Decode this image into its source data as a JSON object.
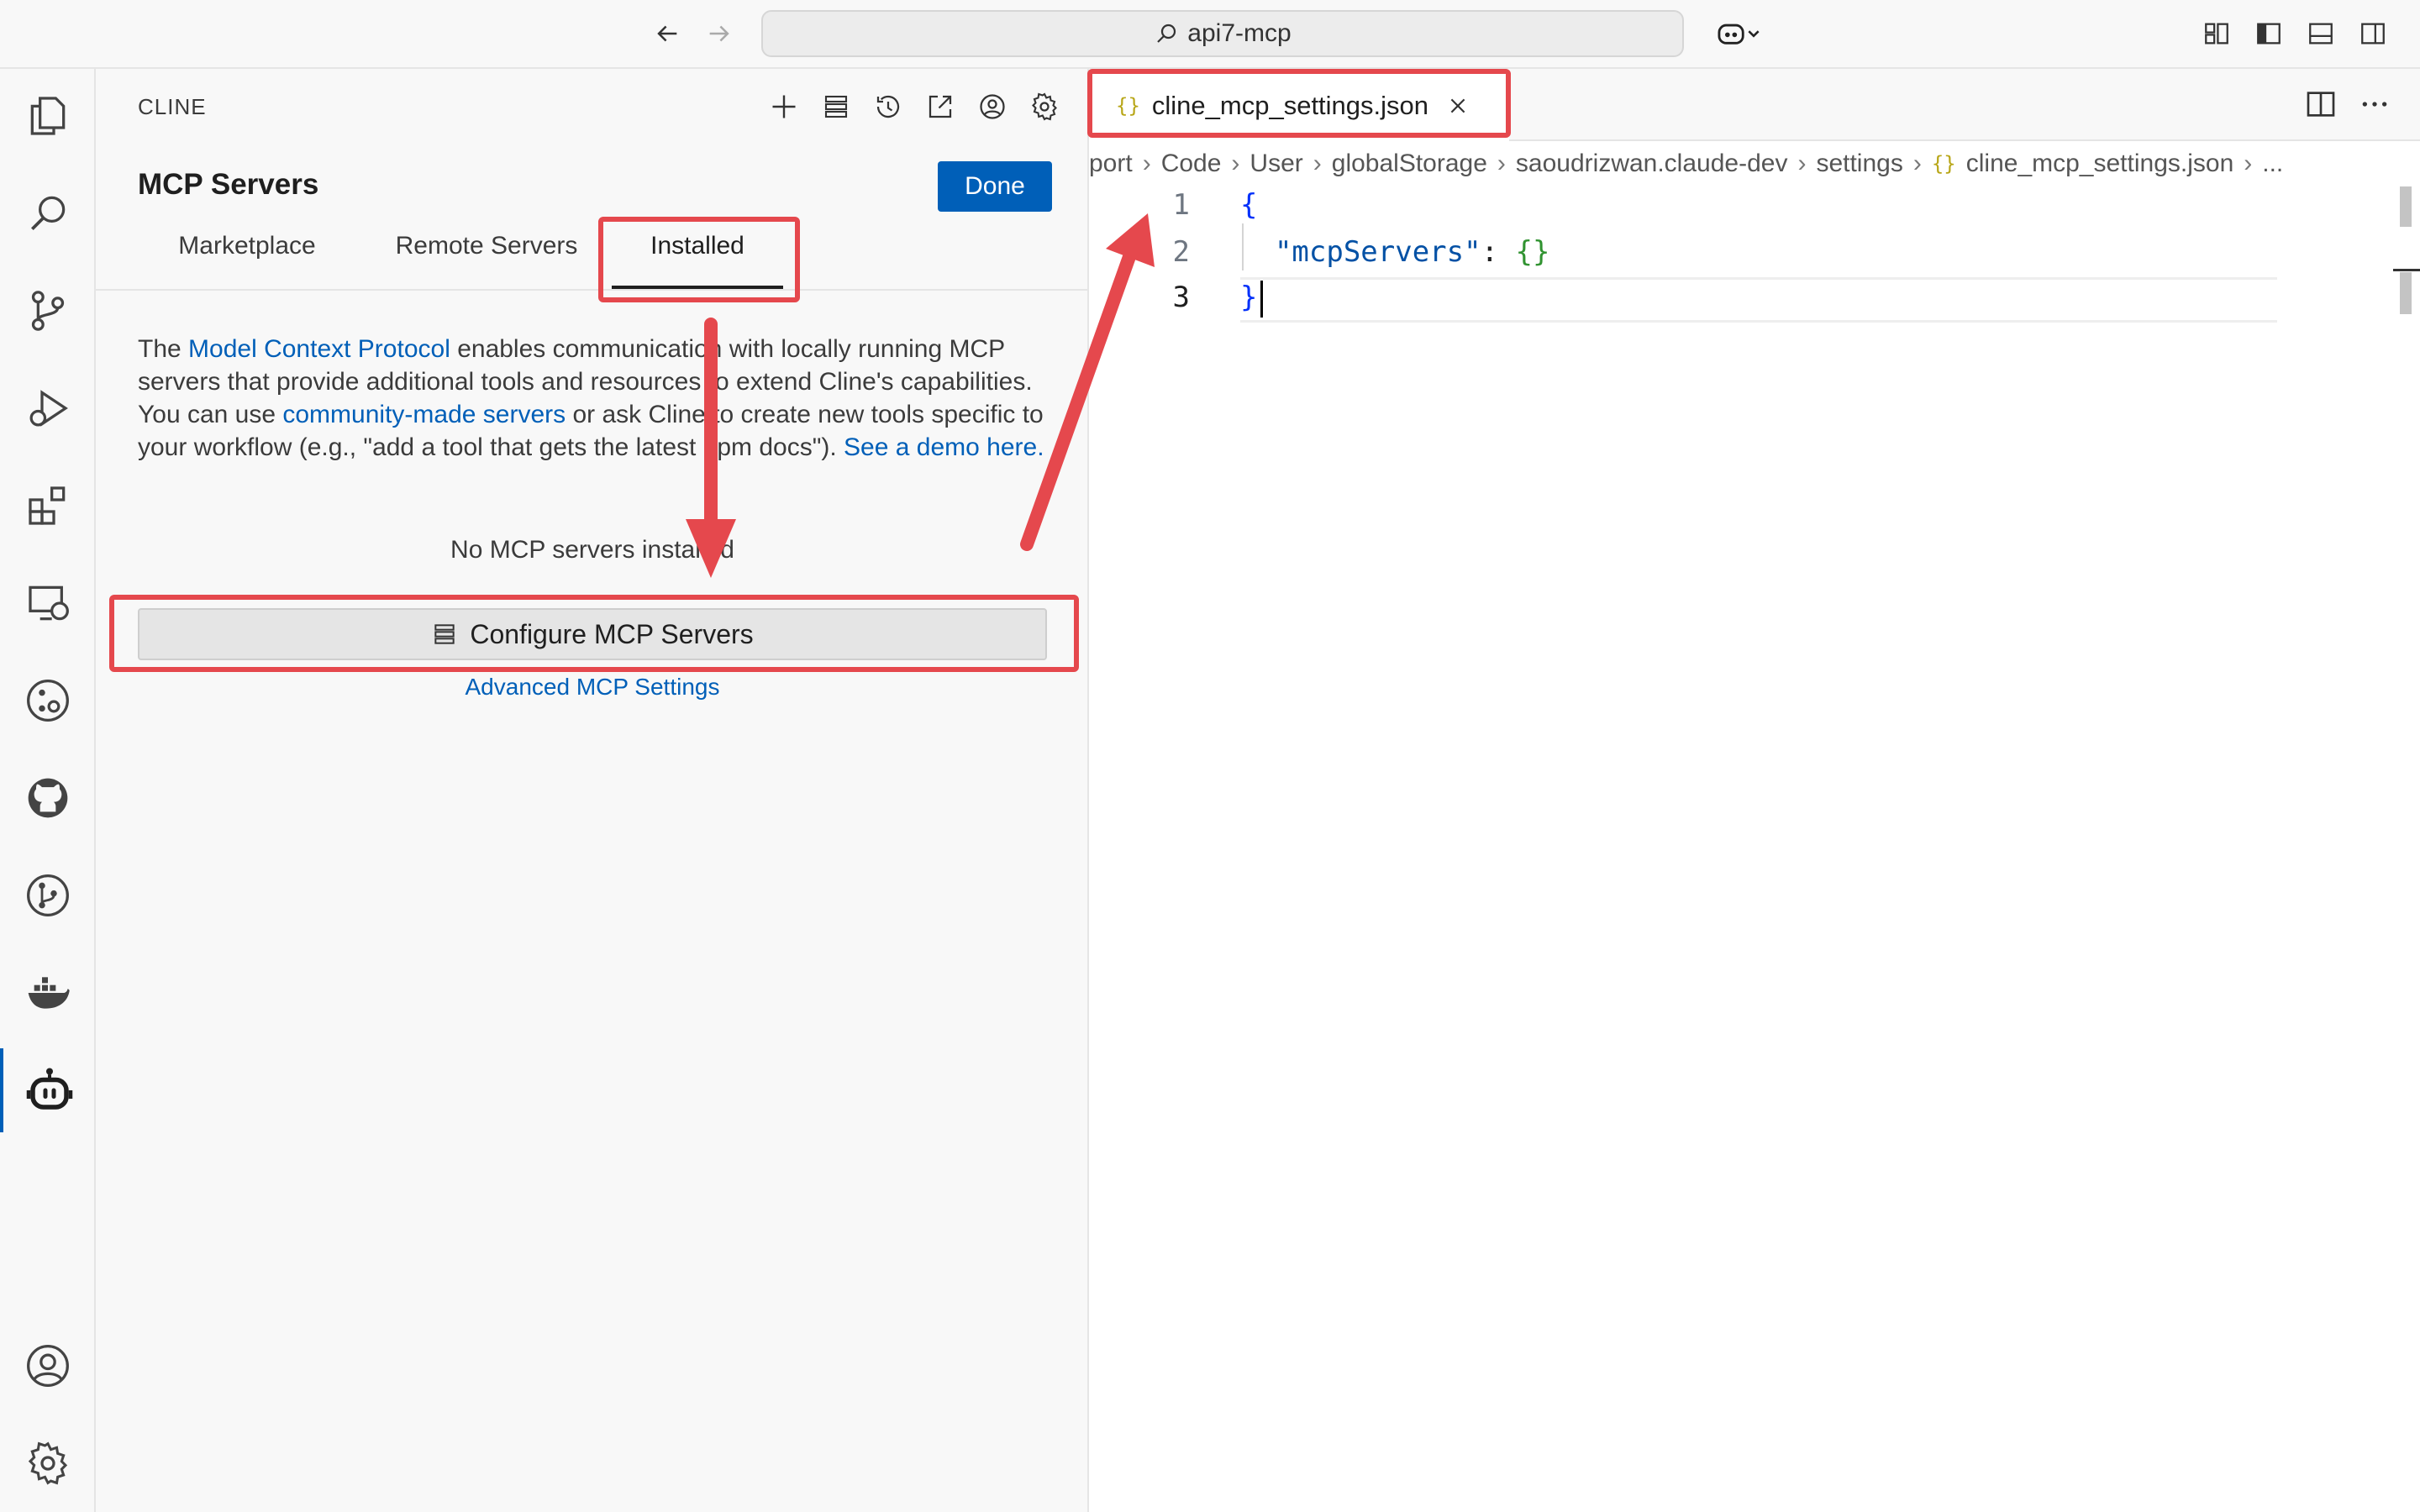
{
  "titlebar": {
    "search_text": "api7-mcp"
  },
  "sidebar": {
    "title": "CLINE",
    "heading": "MCP Servers",
    "done_label": "Done",
    "tabs": [
      {
        "label": "Marketplace"
      },
      {
        "label": "Remote Servers"
      },
      {
        "label": "Installed"
      }
    ],
    "description": {
      "p1": "The ",
      "link1": "Model Context Protocol",
      "p2": " enables communication with locally running MCP servers that provide additional tools and resources to extend Cline's capabilities. You can use ",
      "link2": "community-made servers",
      "p3": " or ask Cline to create new tools specific to your workflow (e.g., \"add a tool that gets the latest npm docs\"). ",
      "link3": "See a demo here."
    },
    "empty_text": "No MCP servers installed",
    "configure_label": "Configure MCP Servers",
    "advanced_label": "Advanced MCP Settings"
  },
  "editor": {
    "tab_label": "cline_mcp_settings.json",
    "breadcrumbs": [
      "port",
      "Code",
      "User",
      "globalStorage",
      "saoudrizwan.claude-dev",
      "settings",
      "cline_mcp_settings.json",
      "..."
    ],
    "lines": [
      {
        "num": "1",
        "text": "{"
      },
      {
        "num": "2",
        "key": "\"mcpServers\"",
        "colon": ": ",
        "val": "{}"
      },
      {
        "num": "3",
        "text": "}"
      }
    ]
  },
  "colors": {
    "accent": "#005fb8",
    "annotation": "#e5484d"
  }
}
